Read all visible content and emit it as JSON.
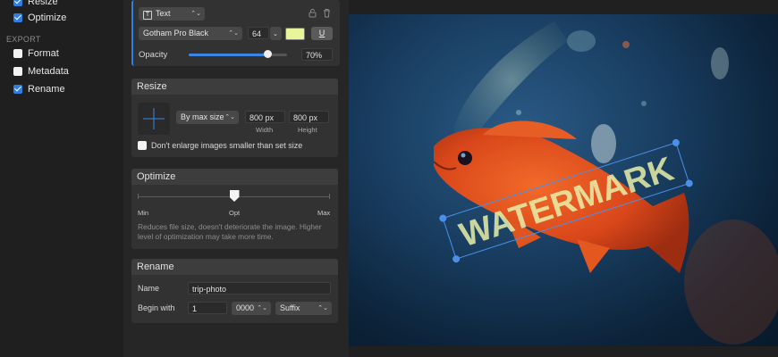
{
  "sidebar": {
    "items_top": [
      {
        "label": "Resize",
        "checked": true
      },
      {
        "label": "Optimize",
        "checked": true
      }
    ],
    "export_header": "EXPORT",
    "export_items": [
      {
        "label": "Format",
        "checked": false
      },
      {
        "label": "Metadata",
        "checked": false
      },
      {
        "label": "Rename",
        "checked": true
      }
    ]
  },
  "watermark_panel": {
    "type_select": "Text",
    "font_select": "Gotham Pro Black",
    "font_size": "64",
    "color": "#e8f59a",
    "underline_glyph": "U",
    "opacity_label": "Opacity",
    "opacity_value": "70%",
    "opacity_fraction": 0.8
  },
  "resize_panel": {
    "title": "Resize",
    "mode_select": "By max size",
    "width_value": "800 px",
    "width_label": "Width",
    "height_value": "800 px",
    "height_label": "Height",
    "enlarge_checkbox": "Don't enlarge images smaller than set size"
  },
  "optimize_panel": {
    "title": "Optimize",
    "min_label": "Min",
    "opt_label": "Opt",
    "max_label": "Max",
    "level_fraction": 0.5,
    "description": "Reduces file size, doesn't deteriorate the image. Higher level of optimization may take more time."
  },
  "rename_panel": {
    "title": "Rename",
    "name_label": "Name",
    "name_value": "trip-photo",
    "begin_label": "Begin with",
    "begin_value": "1",
    "digits_select": "0000",
    "suffix_select": "Suffix"
  },
  "preview": {
    "watermark_text": "WATERMARK",
    "watermark_color": "#e9f0a8"
  }
}
